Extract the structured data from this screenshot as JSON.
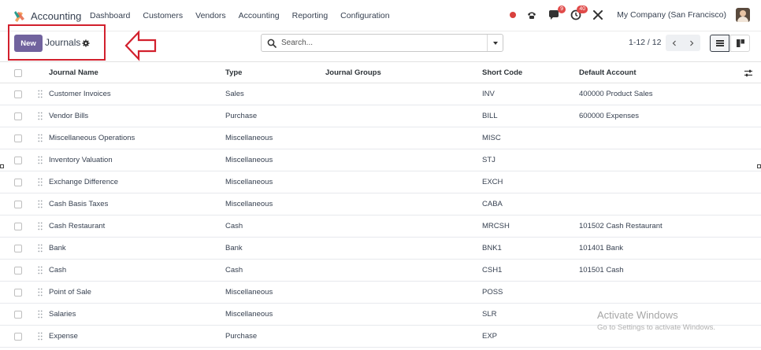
{
  "navbar": {
    "app_name": "Accounting",
    "menu": [
      "Dashboard",
      "Customers",
      "Vendors",
      "Accounting",
      "Reporting",
      "Configuration"
    ],
    "chat_badge": "9",
    "activity_badge": "40",
    "company": "My Company (San Francisco)"
  },
  "control_panel": {
    "new_label": "New",
    "title": "Journals",
    "search_placeholder": "Search...",
    "pager": "1-12 / 12"
  },
  "table": {
    "columns": [
      "Journal Name",
      "Type",
      "Journal Groups",
      "Short Code",
      "Default Account"
    ],
    "rows": [
      {
        "name": "Customer Invoices",
        "type": "Sales",
        "groups": "",
        "code": "INV",
        "account": "400000 Product Sales"
      },
      {
        "name": "Vendor Bills",
        "type": "Purchase",
        "groups": "",
        "code": "BILL",
        "account": "600000 Expenses"
      },
      {
        "name": "Miscellaneous Operations",
        "type": "Miscellaneous",
        "groups": "",
        "code": "MISC",
        "account": ""
      },
      {
        "name": "Inventory Valuation",
        "type": "Miscellaneous",
        "groups": "",
        "code": "STJ",
        "account": ""
      },
      {
        "name": "Exchange Difference",
        "type": "Miscellaneous",
        "groups": "",
        "code": "EXCH",
        "account": ""
      },
      {
        "name": "Cash Basis Taxes",
        "type": "Miscellaneous",
        "groups": "",
        "code": "CABA",
        "account": ""
      },
      {
        "name": "Cash Restaurant",
        "type": "Cash",
        "groups": "",
        "code": "MRCSH",
        "account": "101502 Cash Restaurant"
      },
      {
        "name": "Bank",
        "type": "Bank",
        "groups": "",
        "code": "BNK1",
        "account": "101401 Bank"
      },
      {
        "name": "Cash",
        "type": "Cash",
        "groups": "",
        "code": "CSH1",
        "account": "101501 Cash"
      },
      {
        "name": "Point of Sale",
        "type": "Miscellaneous",
        "groups": "",
        "code": "POSS",
        "account": ""
      },
      {
        "name": "Salaries",
        "type": "Miscellaneous",
        "groups": "",
        "code": "SLR",
        "account": ""
      },
      {
        "name": "Expense",
        "type": "Purchase",
        "groups": "",
        "code": "EXP",
        "account": ""
      }
    ]
  },
  "watermark": {
    "line1": "Activate Windows",
    "line2": "Go to Settings to activate Windows."
  },
  "colors": {
    "primary_button": "#71639e",
    "annotation": "#d2202d",
    "badge": "#e04a49"
  }
}
